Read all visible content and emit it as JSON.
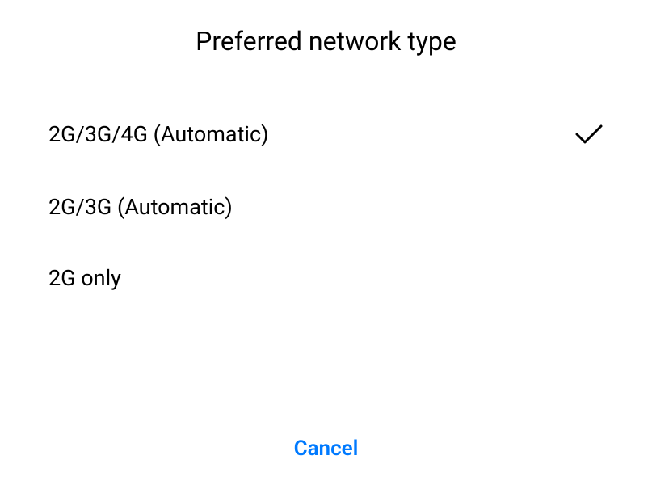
{
  "dialog": {
    "title": "Preferred network type",
    "options": [
      {
        "label": "2G/3G/4G (Automatic)",
        "selected": true
      },
      {
        "label": "2G/3G (Automatic)",
        "selected": false
      },
      {
        "label": "2G only",
        "selected": false
      }
    ],
    "cancel_label": "Cancel"
  }
}
